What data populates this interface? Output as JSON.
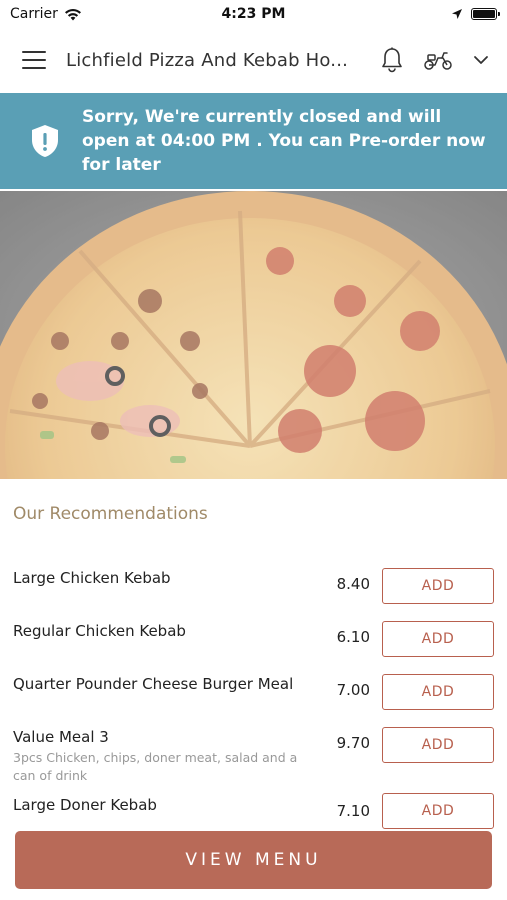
{
  "status_bar": {
    "carrier": "Carrier",
    "time": "4:23 PM"
  },
  "header": {
    "title": "Lichfield Pizza And Kebab Ho...",
    "icons": [
      "menu-icon",
      "bell-icon",
      "scooter-icon",
      "chevron-down-icon"
    ]
  },
  "banner": {
    "text": "Sorry, We're currently closed and will open at 04:00 PM . You can Pre-order now for later",
    "icon": "shield-alert-icon",
    "color": "#5a9fb5"
  },
  "hero": {
    "icon": "pizza-image"
  },
  "recommendations": {
    "title": "Our Recommendations",
    "add_label": "ADD",
    "items": [
      {
        "name": "Large Chicken Kebab",
        "description": "",
        "price": "8.40"
      },
      {
        "name": "Regular Chicken Kebab",
        "description": "",
        "price": "6.10"
      },
      {
        "name": "Quarter Pounder Cheese Burger Meal",
        "description": "",
        "price": "7.00"
      },
      {
        "name": "Value Meal 3",
        "description": "3pcs Chicken, chips, doner meat, salad and a can of drink",
        "price": "9.70"
      },
      {
        "name": "Large Doner Kebab",
        "description": "",
        "price": "7.10"
      }
    ]
  },
  "footer": {
    "view_menu_label": "VIEW MENU",
    "accent": "#b86a58"
  }
}
